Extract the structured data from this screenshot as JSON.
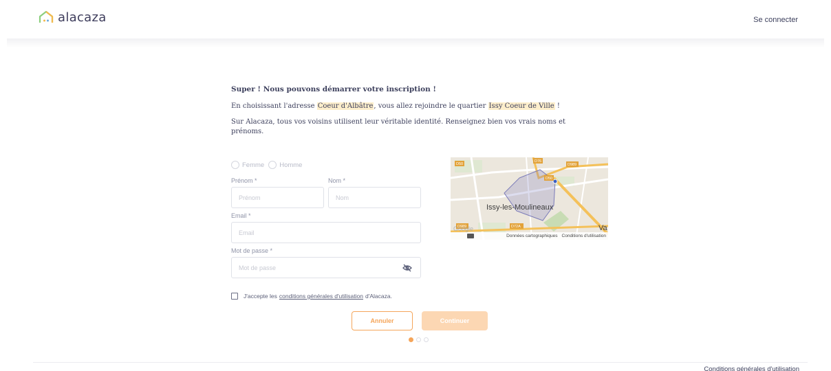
{
  "header": {
    "logo_text": "alacaza",
    "login_label": "Se connecter"
  },
  "intro": {
    "title": "Super ! Nous pouvons démarrer votre inscription !",
    "line1_prefix": "En choisissant l'adresse ",
    "address": "Coeur d'Albâtre",
    "line1_mid": ", vous allez rejoindre le quartier ",
    "neighborhood": "Issy Coeur de Ville",
    "line1_suffix": " !",
    "line2": "Sur Alacaza, tous vos voisins utilisent leur véritable identité. Renseignez bien vos vrais noms et prénoms."
  },
  "form": {
    "gender_female": "Femme",
    "gender_male": "Homme",
    "first_name_label": "Prénom *",
    "first_name_placeholder": "Prénom",
    "last_name_label": "Nom *",
    "last_name_placeholder": "Nom",
    "email_label": "Email *",
    "email_placeholder": "Email",
    "password_label": "Mot de passe *",
    "password_placeholder": "Mot de passe",
    "terms_prefix": "J'accepte les",
    "terms_link": "conditions générales d'utilisation",
    "terms_suffix": "d'Alacaza.",
    "cancel_label": "Annuler",
    "continue_label": "Continuer"
  },
  "steps": {
    "current": 1,
    "total": 3
  },
  "map": {
    "city_label": "Issy-les-Moulineaux",
    "edge_label": "Va",
    "road_labels": [
      "D50",
      "D76",
      "D989",
      "D50",
      "D989",
      "D72A"
    ],
    "footer_data": "Données cartographiques",
    "footer_terms": "Conditions d'utilisation",
    "google": "Google"
  },
  "footer": {
    "terms_link": "Conditions générales d'utilisation"
  },
  "colors": {
    "accent": "#f5a55a",
    "accent_light": "#fcd7b3",
    "highlight": "#fdeecb",
    "text": "#3c3f5c"
  }
}
